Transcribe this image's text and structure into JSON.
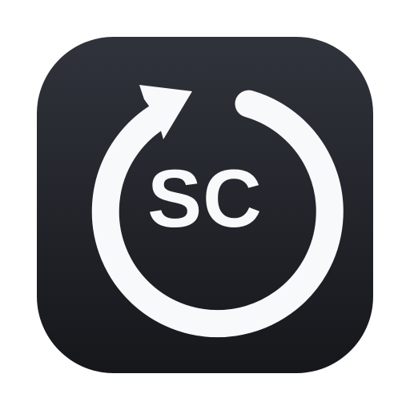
{
  "icon": {
    "name": "sync-sc-app-icon",
    "monogram": "SC",
    "colors": {
      "tile_top": "#30333b",
      "tile_bottom": "#15171b",
      "foreground": "#f8f9fa",
      "background": "#ffffff"
    }
  }
}
